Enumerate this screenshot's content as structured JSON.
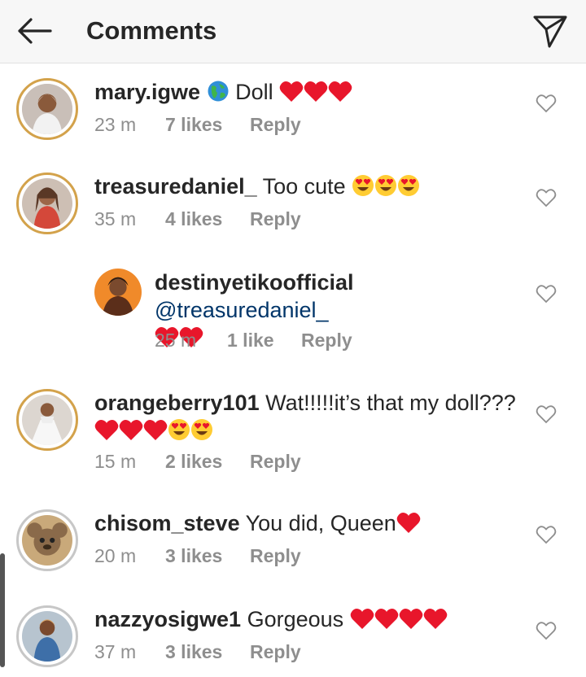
{
  "header": {
    "title": "Comments"
  },
  "comments": [
    {
      "username": "mary.igwe",
      "text_suffix": " Doll",
      "time": "23 m",
      "likes": "7 likes",
      "reply": "Reply",
      "globe": true,
      "hearts": 3,
      "hearteyes": 0
    },
    {
      "username": "treasuredaniel_",
      "text_suffix": " Too cute",
      "time": "35 m",
      "likes": "4 likes",
      "reply": "Reply",
      "hearts": 0,
      "hearteyes": 3
    },
    {
      "username": "destinyetikoofficial",
      "mention": "@treasuredaniel_",
      "time": "25 m",
      "likes": "1 like",
      "reply": "Reply",
      "hearts": 2,
      "hearteyes": 0
    },
    {
      "username": "orangeberry101",
      "text_suffix": " Wat!!!!!it’s that my doll???",
      "time": "15 m",
      "likes": "2 likes",
      "reply": "Reply",
      "hearts": 3,
      "hearteyes": 2
    },
    {
      "username": "chisom_steve",
      "text_suffix": " You did, Queen",
      "time": "20 m",
      "likes": "3 likes",
      "reply": "Reply",
      "hearts": 1,
      "hearteyes": 0
    },
    {
      "username": "nazzyosigwe1",
      "text_suffix": " Gorgeous ",
      "time": "37 m",
      "likes": "3 likes",
      "reply": "Reply",
      "hearts": 4,
      "hearteyes": 0
    }
  ],
  "colors": {
    "heart": "#e8162b",
    "username": "#262626",
    "meta": "#8e8e8e",
    "mention": "#003569",
    "header_bg": "#f7f7f7"
  },
  "icons": {
    "back": "arrow-left-icon",
    "share": "paper-plane-icon",
    "like": "heart-outline-icon"
  }
}
